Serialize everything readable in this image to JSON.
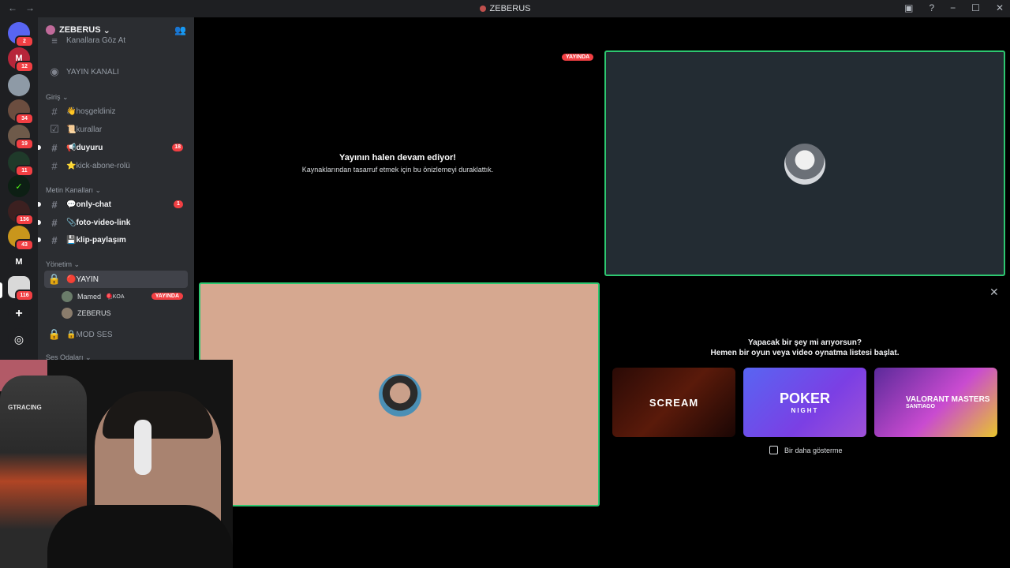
{
  "titlebar": {
    "title": "ZEBERUS",
    "back": "←",
    "forward": "→",
    "minimize": "−",
    "maximize": "☐",
    "close": "✕",
    "inbox": "▣",
    "help": "?"
  },
  "guilds": [
    {
      "label": "",
      "badge": "2"
    },
    {
      "label": "M",
      "badge": "12"
    },
    {
      "label": "",
      "badge": ""
    },
    {
      "label": "",
      "badge": "34"
    },
    {
      "label": "",
      "badge": "19"
    },
    {
      "label": "",
      "badge": "11"
    },
    {
      "label": "",
      "badge": ""
    },
    {
      "label": "",
      "badge": "136"
    },
    {
      "label": "",
      "badge": "43"
    },
    {
      "label": "M",
      "badge": ""
    },
    {
      "label": "",
      "badge": "116"
    }
  ],
  "guild_actions": {
    "add": "+",
    "explore": "◎"
  },
  "server": {
    "name": "ZEBERUS",
    "chevron": "⌄"
  },
  "channels": {
    "browse": "Kanallara Göz At",
    "stream_channel": "YAYIN KANALI",
    "cat_giris": "Giriş",
    "hosgeldiniz": "👋hoşgeldiniz",
    "kurallar": "📜kurallar",
    "duyuru": "📢duyuru",
    "duyuru_count": "18",
    "kick": "⭐kick-abone-rolü",
    "cat_metin": "Metin Kanalları",
    "only_chat": "💬only-chat",
    "only_chat_count": "1",
    "foto": "📎foto-video-link",
    "klip": "💾klip-paylaşım",
    "cat_yonetim": "Yönetim",
    "yayin": "🔴YAYIN",
    "user1_name": "Mamed",
    "user1_extra": "🪀KOA",
    "user1_live": "YAYINDA",
    "user2_name": "ZEBERUS",
    "modses": "🔒MOD SES",
    "cat_ses": "Ses Odaları"
  },
  "webcam": {
    "chair_text": "GTRACING"
  },
  "stage": {
    "live_tag": "YAYINDA",
    "paused_title": "Yayının halen devam ediyor!",
    "paused_sub": "Kaynaklarından tasarruf etmek için bu önizlemeyi duraklattık.",
    "promo_line1": "Yapacak bir şey mi arıyorsun?",
    "promo_line2": "Hemen bir oyun veya video oynatma listesi başlat.",
    "card1": "SCREAM",
    "card2": "POKER",
    "card2_sub": "NIGHT",
    "card3": "VALORANT MASTERS",
    "card3_sub": "SANTIAGO",
    "dont_show": "Bir daha gösterme",
    "close": "✕"
  }
}
